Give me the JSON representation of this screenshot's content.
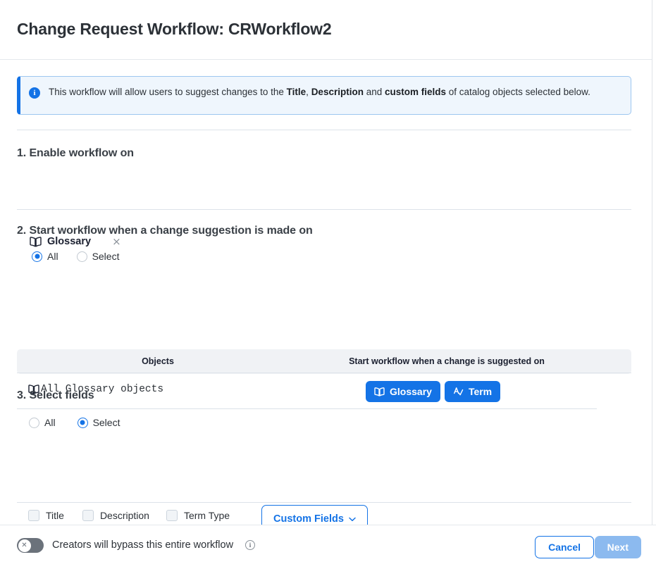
{
  "header": {
    "title": "Change Request Workflow: CRWorkflow2"
  },
  "banner": {
    "icon": "info-icon",
    "lead": "This workflow will allow users to suggest changes to the ",
    "bold1": "Title",
    "sep1": ", ",
    "bold2": "Description",
    "sep2": " and ",
    "bold3": "custom fields",
    "tail": " of catalog objects selected below."
  },
  "section1": {
    "title": "1. Enable workflow on",
    "chip": {
      "icon": "book-icon",
      "label": "Glossary",
      "remove": "×"
    }
  },
  "section2": {
    "title": "2. Start workflow when a change suggestion is made on",
    "options": [
      {
        "label": "All",
        "selected": true
      },
      {
        "label": "Select",
        "selected": false
      }
    ],
    "table": {
      "columns": [
        "Objects",
        "Start workflow when a change is suggested on"
      ],
      "rows": [
        {
          "object_icon": "book-icon",
          "object": "All Glossary objects",
          "chips": [
            {
              "icon": "book-icon",
              "label": "Glossary"
            },
            {
              "icon": "term-icon",
              "label": "Term"
            }
          ]
        }
      ]
    }
  },
  "section3": {
    "title": "3. Select fields",
    "options": [
      {
        "label": "All",
        "selected": false
      },
      {
        "label": "Select",
        "selected": true
      }
    ],
    "checkboxes": [
      {
        "label": "Title",
        "checked": false
      },
      {
        "label": "Description",
        "checked": false
      },
      {
        "label": "Term Type",
        "checked": false
      }
    ],
    "custom_fields_button": {
      "label": "Custom Fields",
      "caret": "⌄"
    }
  },
  "footer": {
    "toggle": {
      "state": "off",
      "knob_glyph": "✕"
    },
    "toggle_label": "Creators will bypass this entire workflow",
    "help_icon": "i",
    "cancel_label": "Cancel",
    "next_label": "Next"
  },
  "colors": {
    "accent": "#1473e6",
    "accent_disabled": "#8cbaef",
    "banner_bg": "#eff6fd",
    "table_head_bg": "#f0f2f5",
    "text": "#2c3137",
    "toggle_off": "#6b727b"
  }
}
